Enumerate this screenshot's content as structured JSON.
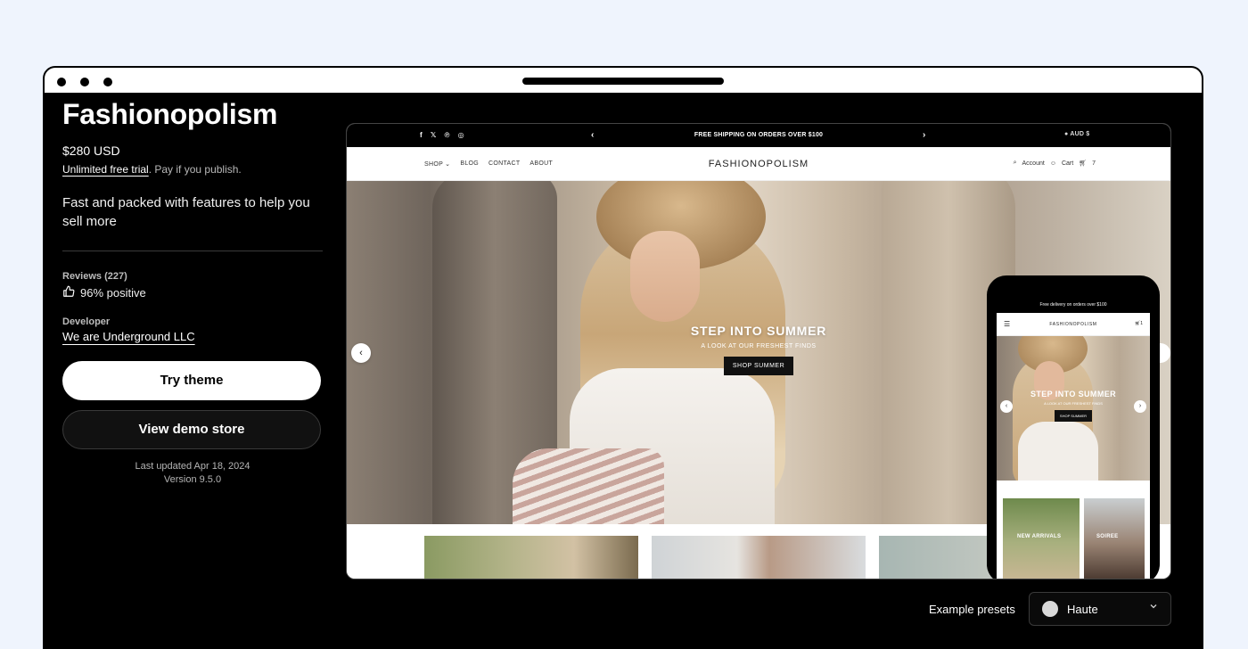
{
  "theme": {
    "title": "Fashionopolism",
    "price": "$280 USD",
    "trial_link": "Unlimited free trial",
    "trial_suffix": ". Pay if you publish.",
    "tagline": "Fast and packed with features to help you sell more",
    "reviews_label": "Reviews (227)",
    "reviews_positive": "96% positive",
    "developer_label": "Developer",
    "developer_name": "We are Underground LLC",
    "try_button": "Try theme",
    "demo_button": "View demo store",
    "last_updated": "Last updated Apr 18, 2024",
    "version": "Version 9.5.0"
  },
  "preview": {
    "announcement": "FREE SHIPPING ON ORDERS OVER $100",
    "currency": "AUD $",
    "social_icons": [
      "facebook-icon",
      "x-icon",
      "pinterest-icon",
      "instagram-icon"
    ],
    "nav_links": [
      "SHOP",
      "BLOG",
      "CONTACT",
      "ABOUT"
    ],
    "brand": "FASHIONOPOLISM",
    "account_label": "Account",
    "cart_label": "Cart",
    "cart_count": "7",
    "hero_heading": "STEP INTO SUMMER",
    "hero_sub": "A LOOK AT OUR FRESHEST FINDS",
    "hero_button": "SHOP SUMMER"
  },
  "mobile": {
    "announcement": "Free delivery on orders over $100",
    "brand": "FASHIONOPOLISM",
    "cart_count": "1",
    "hero_heading": "STEP INTO SUMMER",
    "hero_sub": "A LOOK AT OUR FRESHEST FINDS",
    "hero_button": "SHOP SUMMER",
    "card1_label": "NEW ARRIVALS",
    "card2_label": "SOIREE"
  },
  "presets": {
    "label": "Example presets",
    "selected": "Haute",
    "swatch_color": "#d9d9d9"
  },
  "colors": {
    "page_bg": "#eff4fd",
    "panel_bg": "#000000",
    "button_primary_bg": "#ffffff"
  }
}
